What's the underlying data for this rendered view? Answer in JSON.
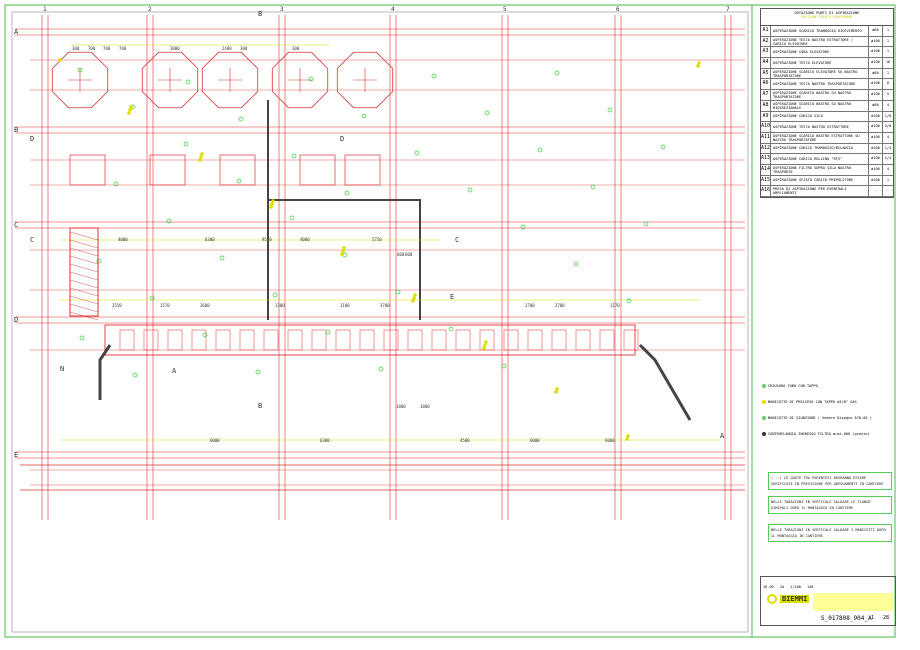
{
  "grid": {
    "columns": [
      "1",
      "2",
      "3",
      "4",
      "5",
      "6",
      "7"
    ],
    "rows": [
      "A",
      "B",
      "C",
      "D",
      "E"
    ]
  },
  "section_markers": [
    "A",
    "A",
    "B",
    "B",
    "C",
    "C",
    "D",
    "D",
    "N",
    "E"
  ],
  "dimensions": [
    "300",
    "700",
    "700",
    "700",
    "3000",
    "2400",
    "300",
    "300",
    "4000",
    "6300",
    "9550",
    "4000",
    "5750",
    "2550",
    "1570",
    "3600",
    "1300",
    "1100",
    "3700",
    "2700",
    "2700",
    "1170",
    "6000",
    "6300",
    "4500",
    "6000",
    "6000",
    "1800",
    "1800",
    "600",
    "600"
  ],
  "table": {
    "title": "DOTAZIONE PUNTI DI ASPIRAZIONE",
    "subtitle": "SUCTION POINTS EQUIPMENT",
    "rows": [
      {
        "code": "A1",
        "desc": "ASPIRAZIONE SCARICO TRAMOGGIA RICEVIMENTO",
        "dia": "ø80",
        "qty": "1"
      },
      {
        "code": "A2",
        "desc": "ASPIRAZIONE TESTA NASTRO ESTRATTORE / CARICO ELEVATORE",
        "dia": "ø100",
        "qty": "1"
      },
      {
        "code": "A3",
        "desc": "ASPIRAZIONE CODA ELEVATORE",
        "dia": "ø100",
        "qty": "1"
      },
      {
        "code": "A4",
        "desc": "ASPIRAZIONE TESTA ELEVATORE",
        "dia": "ø100",
        "qty": "16"
      },
      {
        "code": "A5",
        "desc": "ASPIRAZIONE SCARICO ELEVATORE SU NASTRO TRASPORTATORE",
        "dia": "ø80",
        "qty": "1"
      },
      {
        "code": "A6",
        "desc": "ASPIRAZIONE TESTA NASTRO TRASPORTATORE",
        "dia": "ø100",
        "qty": "8"
      },
      {
        "code": "A7",
        "desc": "ASPIRAZIONE SCARICO NASTRO SU NASTRO TRASPORTATORE",
        "dia": "ø100",
        "qty": "5"
      },
      {
        "code": "A8",
        "desc": "ASPIRAZIONE SCARICO NASTRO SU NASTRO BIDIREZIONALE",
        "dia": "ø80",
        "qty": "4"
      },
      {
        "code": "A9",
        "desc": "ASPIRAZIONE CARICO SILO",
        "dia": "ø100",
        "qty": "1/8"
      },
      {
        "code": "A10",
        "desc": "ASPIRAZIONE TESTA NASTRO ESTRATTORE",
        "dia": "ø100",
        "qty": "4/8"
      },
      {
        "code": "A11",
        "desc": "ASPIRAZIONE SCARICO NASTRO ESTRATTORE SU NASTRO TRASPORTATORE",
        "dia": "ø100",
        "qty": "4"
      },
      {
        "code": "A12",
        "desc": "ASPIRAZIONE CARICO TRAMOGGIO/BILANCIA",
        "dia": "ø100",
        "qty": "1/4"
      },
      {
        "code": "A13",
        "desc": "ASPIRAZIONE CARICO RULLINO \"RTS\"",
        "dia": "ø100",
        "qty": "1/4"
      },
      {
        "code": "A14",
        "desc": "ASPIRAZIONE FILTRO SOPRA SILO NASTRO TRASPORTO",
        "dia": "ø100",
        "qty": "4"
      },
      {
        "code": "A15",
        "desc": "ASPIRAZIONE SFIATO CARICO PREPULITORE",
        "dia": "ø100",
        "qty": "1"
      },
      {
        "code": "A16",
        "desc": "PRESA DI ASPIRAZIONE PER EVENTUALI AMPLIAMENTI",
        "dia": "-",
        "qty": "-"
      }
    ]
  },
  "legend": [
    {
      "label": "CHIUSURA TUBO CON TAPPO",
      "color": "#66cc66"
    },
    {
      "label": "MANICOTTO DI PRELIEVO CON TAPPO ø3/8\" GAS",
      "color": "#dddd00"
    },
    {
      "label": "MANICOTTO DI GIUNZIONE ( Vedere Disegno 870-05 )",
      "color": "#66cc66"
    },
    {
      "label": "CONTROFLANGIA INGRESSO FILTRO ø=mt.600 (grezzo)",
      "color": "#333333"
    }
  ],
  "notes": [
    "(...) LE QUOTE TRA PARENTESI DOVRANNO ESSERE VERIFICATE IN PREVISIONE PER ADEGUAMENTI IN CANTIERE",
    "NELLE TUBAZIONI IN VERTICALE SALDARE LE FLANGE GIREVOLI DOPO IL MONTAGGIO IN CANTIERE",
    "NELLE TUBAZIONI IN VERTICALE SALDARE I MANICOTTI DOPO IL MONTAGGIO IN CANTIERE"
  ],
  "title_block": {
    "date": "16-05",
    "sheet_count": "34",
    "scale": "1/100",
    "ref": "148",
    "company": "BIEMMI",
    "drawing_number": "S_017808_904_A",
    "revision": "1",
    "sheet": "28"
  },
  "colors": {
    "grid": "#e03030",
    "duct": "#e03030",
    "accent": "#dddd00",
    "frame": "#44bb44",
    "green": "#33cc33"
  }
}
